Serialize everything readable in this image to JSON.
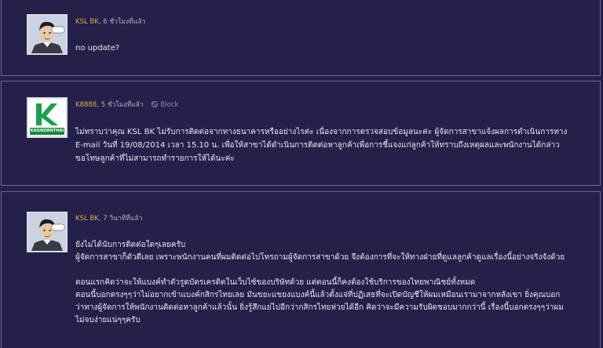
{
  "posts": [
    {
      "author": "KSL BK",
      "time": ", 6 ชั่วโมงที่แล้ว",
      "avatar_icon": "cartoon-man-avatar-icon",
      "paragraphs": [
        "no update?"
      ]
    },
    {
      "author": "K8888",
      "time": ", 5 ชั่วโมงที่แล้ว",
      "block_label": "Block",
      "avatar_icon": "kasikornthai-logo",
      "logo_text": "KASIKORNTHAI",
      "paragraphs": [
        "ไม่ทราบว่าคุณ KSL BK ไม่รับการติดต่อจากทางธนาคารหรืออย่างไรค่ะ เนื่องจากการตรวจสอบข้อมูลนะค่ะ ผู้จัดการสาขาแจ้งผลการดำเนินการทาง E-mail วันที่ 19/08/2014 เวลา 15.10 น. เพื่อให้สาขาได้ดำเนินการติดต่อหาลูกค้าเพื่อการชี้แจงแก่ลูกค้าให้ทราบถึงเหตุผลและพนักงานได้กล่าวขอโทษลูกค้าที่ไม่สามารถทำรายการให้ได้นะค่ะ"
      ]
    },
    {
      "author": "KSL BK",
      "time": ", 7 วินาทีที่แล้ว",
      "avatar_icon": "cartoon-man-avatar-icon",
      "paragraphs": [
        "ยังไม่ได้นับการติดต่อใดๆเลยครับ",
        "ผู้จัดการสาขาก็ตัวดีเลย เพราะพนักงานคนที่ผมติดต่อไปโทรถามผู้จัดการสาขาด้วย จึงต้องการที่จะให้ทางฝ่ายที่ดูแลลูกค้าดูแลเรื่องนี้อย่างจริงจังด้วย",
        "ตอนแรกคิดว่าจะให้แบงค์ทำตัวรูดบัตรเครดิตในเว็บไซ้ของบริษัทด้วย แต่ตอนนี้ก็คงต้องใช้บริการของไทยพาณิชย์ทั้งหมด",
        "ตอนนี้บอกตรงๆๆว่าไม่อยากเข้าแบงค์กสิกรไทยเลย มันขยะแขยงแบงค์นี้แล้วตั้งแจ่ที่ปฏิเสธที่จะเปิดบัญชีให้ผมเหมือนเรามาจากหลังเขา ยิ่งคุณบอกว่าทางผู้จัดการให้พนักงานติดต่อหาลูกค้าแล้วนั้น ยิ่งรู้สึกแย่ไปอีกว่ากสิกรไทยห่วยได้อีก คิดว่าจะมีความรับผิดชอบมากกว่านี้ เรื่องนี้บอกตรงๆๆว่าผมไม่จบง่ายแน่ๆๆครับ"
      ]
    }
  ]
}
